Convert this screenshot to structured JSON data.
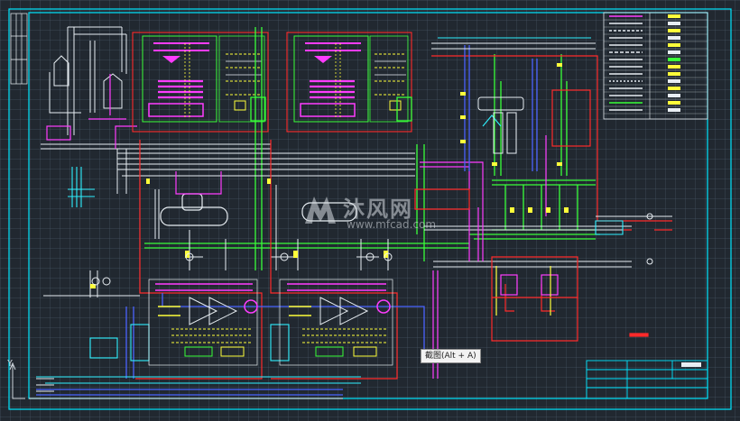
{
  "app": {
    "watermark_text": "沐风网",
    "watermark_url": "www.mfcad.com",
    "tooltip": "截图(Alt + A)",
    "ucs_axis_label": "Y"
  },
  "colors": {
    "background": "#212830",
    "frame": "#00e5ff",
    "red": "#ff2a2a",
    "green": "#39ff39",
    "magenta": "#ff3cff",
    "yellow": "#ffff3a",
    "cyan": "#2ef0ff",
    "white": "#e8eef3",
    "blue": "#4a63ff"
  },
  "icons": {
    "watermark_logo": "mfcad-logo-icon",
    "ucs": "ucs-axis-icon"
  }
}
